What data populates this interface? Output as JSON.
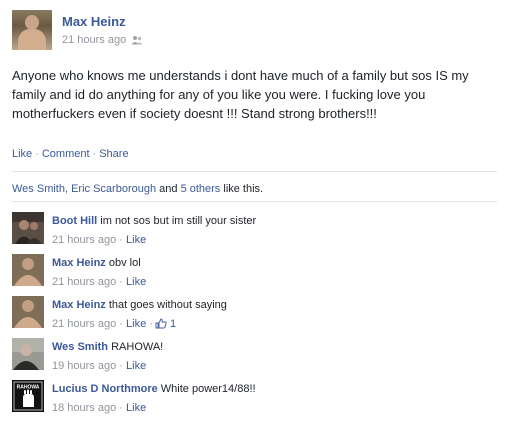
{
  "post": {
    "author": "Max Heinz",
    "time": "21 hours ago",
    "audience_icon": "friends-icon",
    "text": "Anyone who knows me understands i dont have much of a family but sos IS my family and id do anything for any of you like you were. I fucking love you motherfuckers even if society doesnt !!! Stand strong brothers!!!",
    "actions": {
      "like": "Like",
      "comment": "Comment",
      "share": "Share",
      "separator": "·"
    },
    "likes": {
      "names": "Wes Smith, Eric Scarborough",
      "and": "and",
      "others": "5 others",
      "suffix": "like this."
    }
  },
  "comments": [
    {
      "name": "Boot Hill",
      "text": "im not sos but im still your sister",
      "time": "21 hours ago",
      "like": "Like",
      "likes_count": ""
    },
    {
      "name": "Max Heinz",
      "text": "obv lol",
      "time": "21 hours ago",
      "like": "Like",
      "likes_count": ""
    },
    {
      "name": "Max Heinz",
      "text": "that goes without saying",
      "time": "21 hours ago",
      "like": "Like",
      "likes_count": "1"
    },
    {
      "name": "Wes Smith",
      "text": "RAHOWA!",
      "time": "19 hours ago",
      "like": "Like",
      "likes_count": ""
    },
    {
      "name": "Lucius D Northmore",
      "text": "White power14/88!!",
      "time": "18 hours ago",
      "like": "Like",
      "likes_count": ""
    }
  ],
  "meta_separator": "·",
  "avatar_badge_text": "RAHOWA",
  "colors": {
    "link": "#3b5998",
    "meta": "#90949c",
    "text": "#1d2129"
  }
}
